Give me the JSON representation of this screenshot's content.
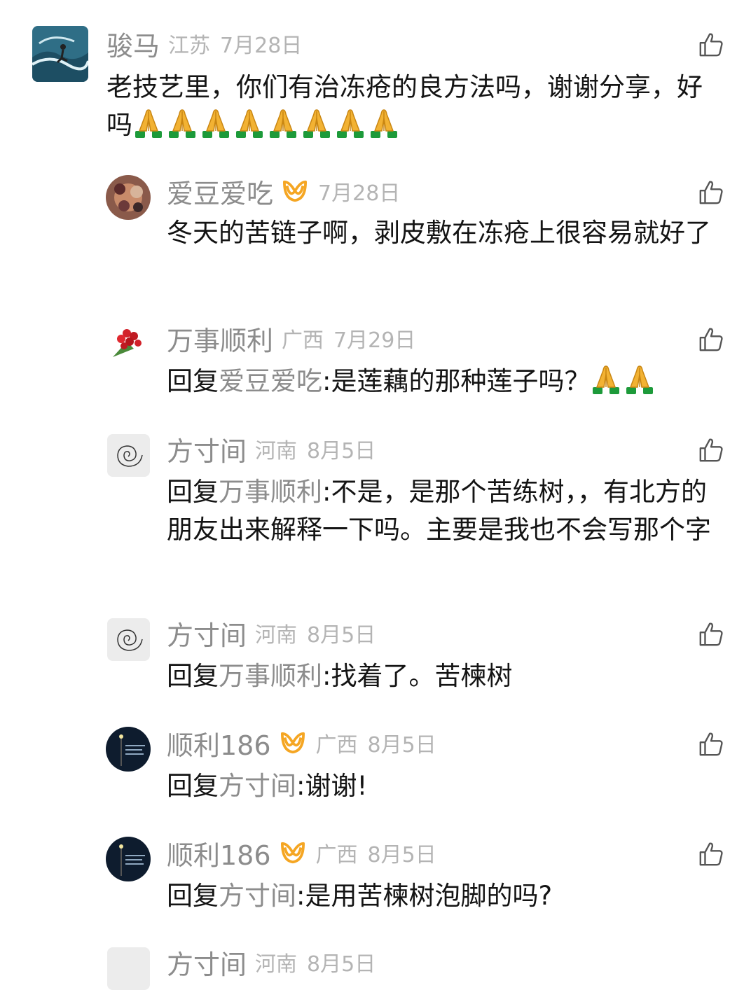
{
  "comments": [
    {
      "name": "骏马",
      "location": "江苏",
      "date": "7月28日",
      "text": "老技艺里，你们有治冻疮的良方法吗，谢谢分享，好吗",
      "emoji": [
        "🙏",
        "🙏",
        "🙏",
        "🙏",
        "🙏",
        "🙏",
        "🙏",
        "🙏"
      ]
    },
    {
      "name": "爱豆爱吃",
      "vip": true,
      "date": "7月28日",
      "text": "冬天的苦链子啊，剥皮敷在冻疮上很容易就好了"
    },
    {
      "name": "万事顺利",
      "location": "广西",
      "date": "7月29日",
      "reply_prefix": "回复",
      "reply_to": "爱豆爱吃",
      "text": ":是莲藕的那种莲子吗？",
      "emoji": [
        "🙏",
        "🙏"
      ]
    },
    {
      "name": "方寸间",
      "location": "河南",
      "date": "8月5日",
      "reply_prefix": "回复",
      "reply_to": "万事顺利",
      "text": ":不是，是那个苦练树，，有北方的朋友出来解释一下吗。主要是我也不会写那个字"
    },
    {
      "name": "方寸间",
      "location": "河南",
      "date": "8月5日",
      "reply_prefix": "回复",
      "reply_to": "万事顺利",
      "text": ":找着了。苦楝树"
    },
    {
      "name": "顺利186",
      "vip": true,
      "location": "广西",
      "date": "8月5日",
      "reply_prefix": "回复",
      "reply_to": "方寸间",
      "text": ":谢谢!"
    },
    {
      "name": "顺利186",
      "vip": true,
      "location": "广西",
      "date": "8月5日",
      "reply_prefix": "回复",
      "reply_to": "方寸间",
      "text": ":是用苦楝树泡脚的吗?"
    },
    {
      "name": "方寸间",
      "location": "河南",
      "date": "8月5日"
    }
  ],
  "icons": {
    "like": "thumbs-up-icon",
    "vip": "vip-badge-icon",
    "emoji": "folded-hands-emoji"
  },
  "colors": {
    "vip_orange": "#f5a623",
    "name_gray": "#8c8c8c",
    "meta_gray": "#b4b4b4"
  }
}
